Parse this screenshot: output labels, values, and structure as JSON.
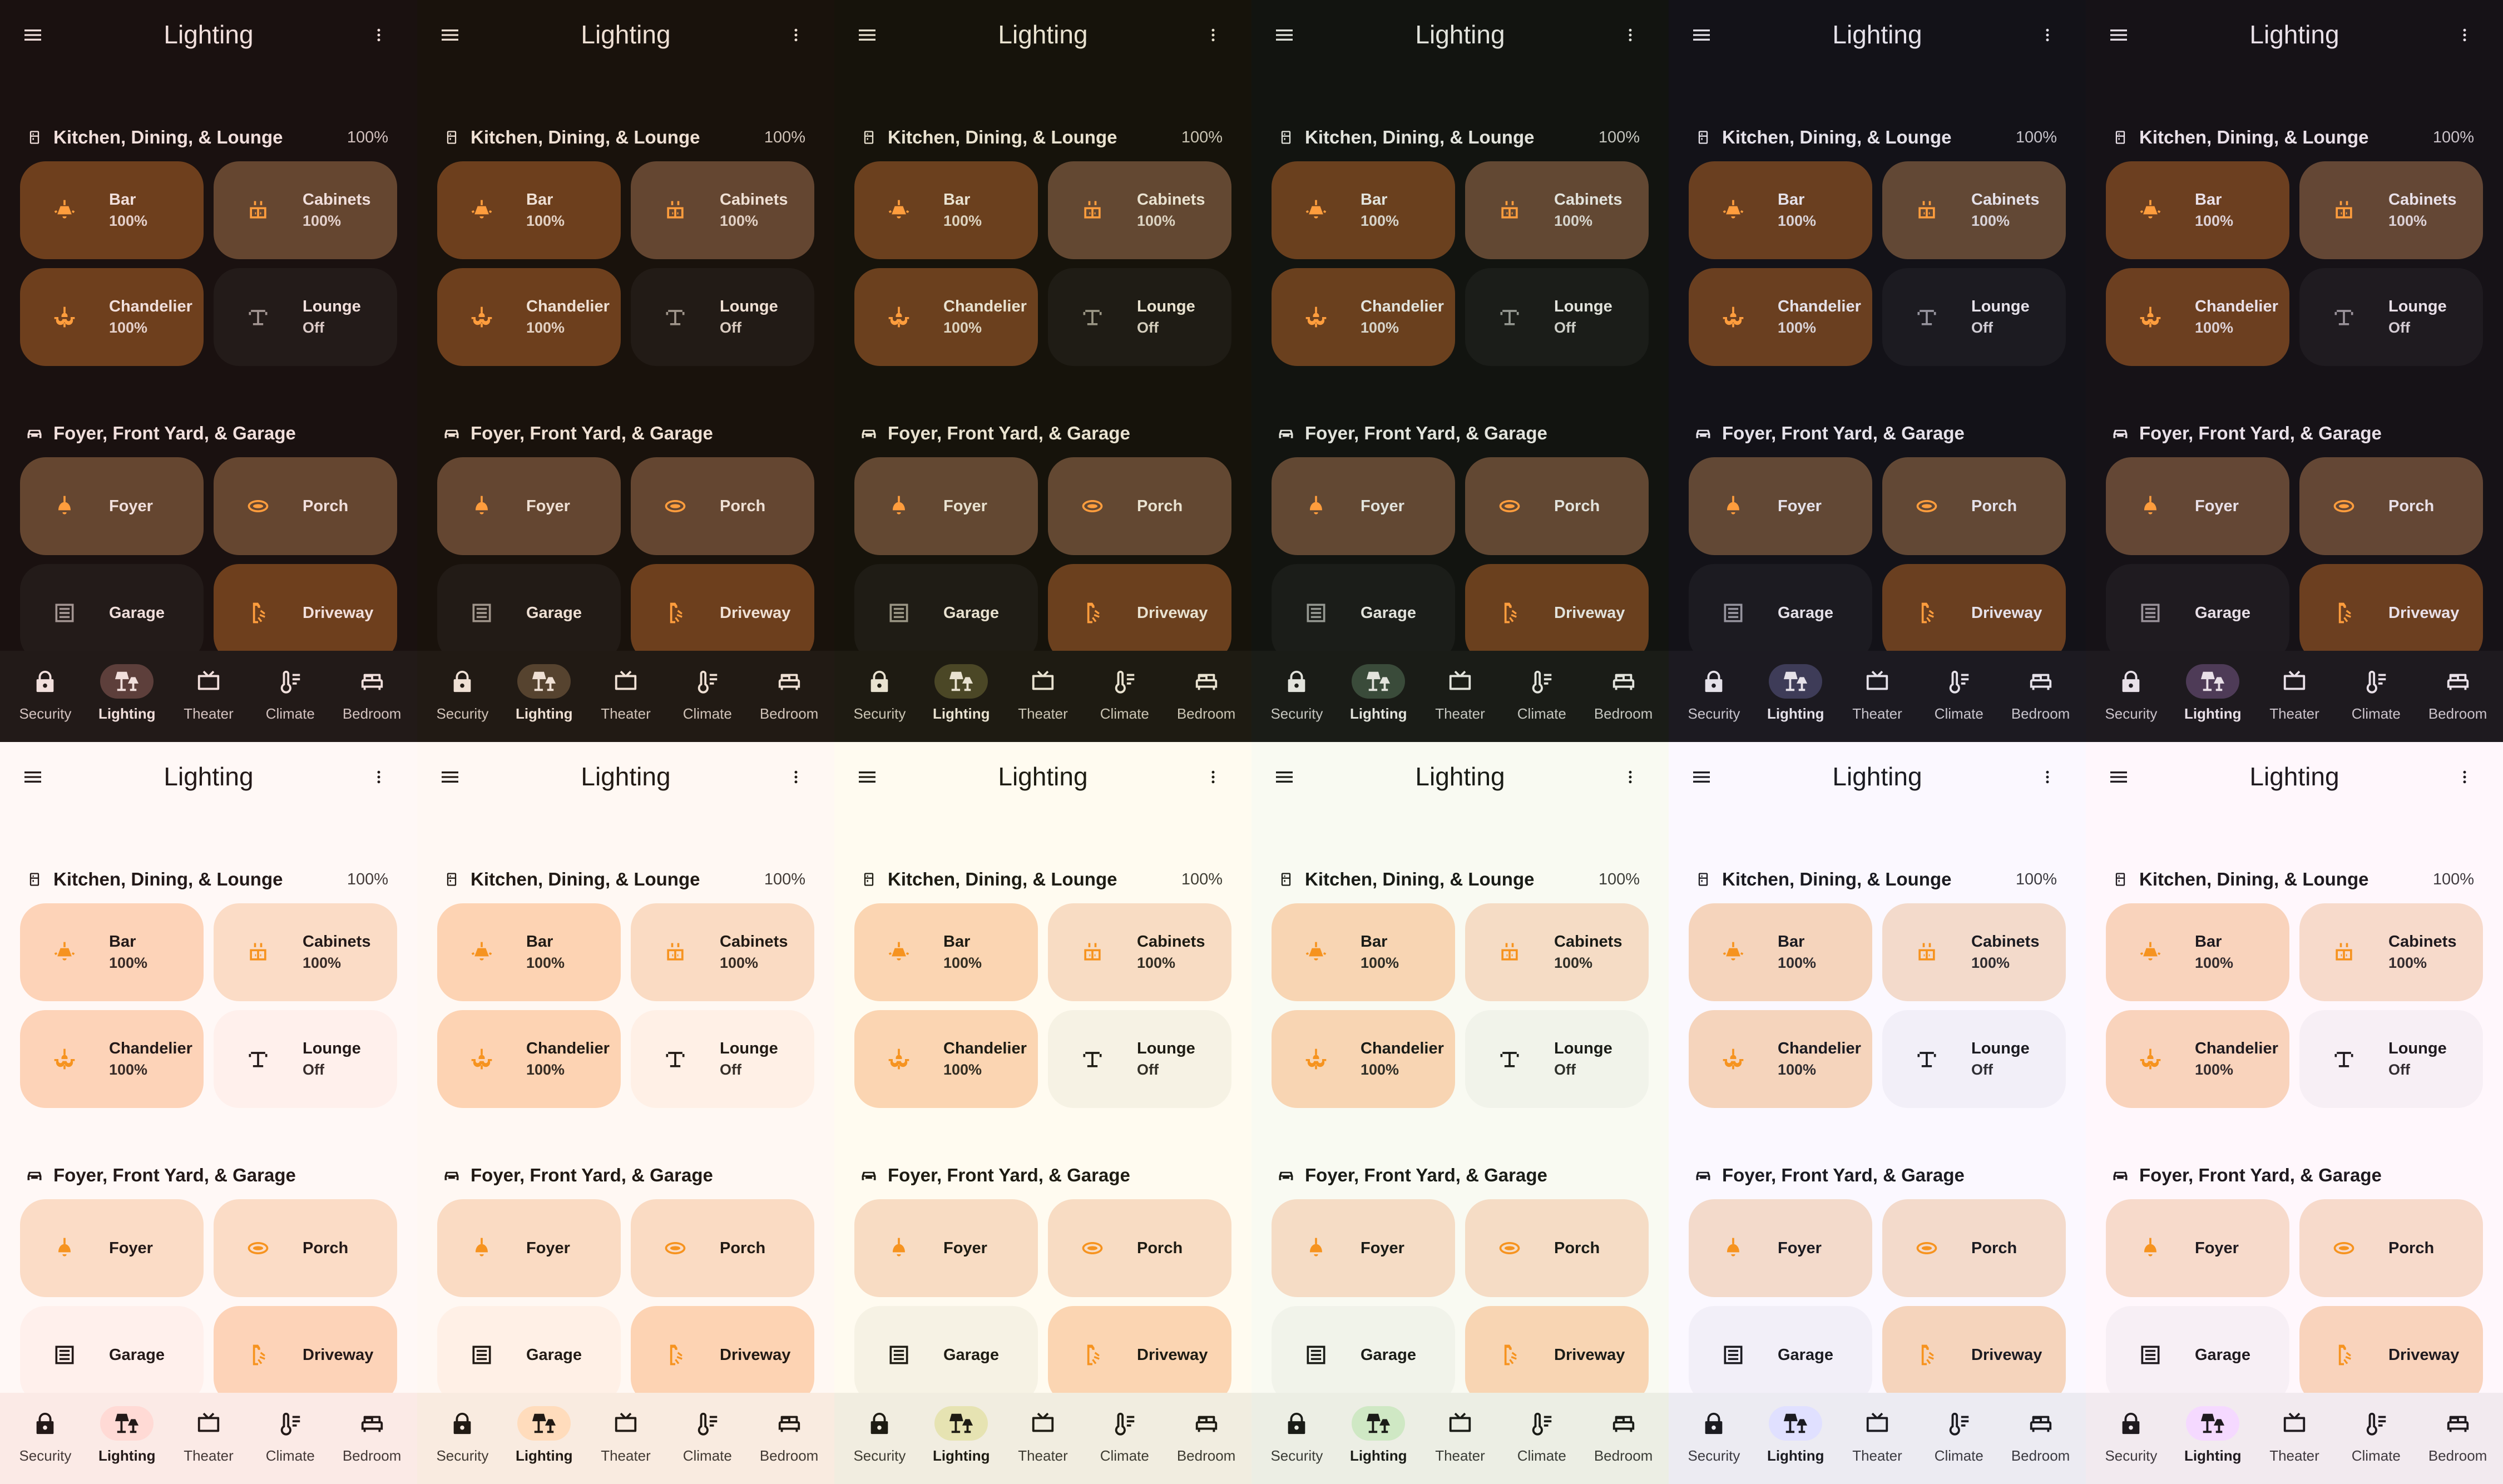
{
  "app_title": "Lighting",
  "sections": [
    {
      "title": "Kitchen, Dining, & Lounge",
      "icon": "fridge-icon",
      "percent": "100%",
      "lights": [
        {
          "name": "Bar",
          "state": "100%",
          "on": true,
          "icon": "ceiling-lamp-icon"
        },
        {
          "name": "Cabinets",
          "state": "100%",
          "on": true,
          "icon": "cabinet-light-icon"
        },
        {
          "name": "Chandelier",
          "state": "100%",
          "on": true,
          "icon": "chandelier-icon"
        },
        {
          "name": "Lounge",
          "state": "Off",
          "on": false,
          "icon": "floor-lamp-icon"
        }
      ]
    },
    {
      "title": "Foyer, Front Yard, & Garage",
      "icon": "car-icon",
      "percent": "",
      "lights": [
        {
          "name": "Foyer",
          "state": "",
          "on": true,
          "icon": "pendant-light-icon"
        },
        {
          "name": "Porch",
          "state": "",
          "on": true,
          "icon": "ring-light-icon"
        },
        {
          "name": "Garage",
          "state": "",
          "on": false,
          "icon": "garage-icon"
        },
        {
          "name": "Driveway",
          "state": "",
          "on": true,
          "icon": "outdoor-lamp-icon"
        }
      ]
    }
  ],
  "nav": [
    {
      "label": "Security",
      "icon": "lock-icon",
      "active": false
    },
    {
      "label": "Lighting",
      "icon": "lamps-icon",
      "active": true
    },
    {
      "label": "Theater",
      "icon": "tv-icon",
      "active": false
    },
    {
      "label": "Climate",
      "icon": "thermometer-icon",
      "active": false
    },
    {
      "label": "Bedroom",
      "icon": "bed-icon",
      "active": false
    }
  ],
  "themes": [
    {
      "bg": "#1a1110",
      "fg": "#f1dfdc",
      "on": "#6e3f1d",
      "on2": "#654630",
      "off": "#231b19",
      "ico": "#ff9d3d",
      "icoOff": "#a39592",
      "nav": "#221a18",
      "pill": "#5d3f3b"
    },
    {
      "bg": "#19120c",
      "fg": "#efe0d4",
      "on": "#6d3f1d",
      "on2": "#644631",
      "off": "#221b16",
      "ico": "#ff9d3d",
      "icoOff": "#a0958b",
      "nav": "#211a14",
      "pill": "#56432f"
    },
    {
      "bg": "#16130b",
      "fg": "#e9e2d0",
      "on": "#6b401e",
      "on2": "#634832",
      "off": "#1f1c15",
      "ico": "#ff9d3d",
      "icoOff": "#9b9685",
      "nav": "#1e1b12",
      "pill": "#4b4726"
    },
    {
      "bg": "#121410",
      "fg": "#e2e3dc",
      "on": "#6a401e",
      "on2": "#624833",
      "off": "#1b1d19",
      "ico": "#ff9d3d",
      "icoOff": "#959891",
      "nav": "#1a1c17",
      "pill": "#3a4b3a"
    },
    {
      "bg": "#131218",
      "fg": "#e5e1e9",
      "on": "#6a3f20",
      "on2": "#624835",
      "off": "#1c1b21",
      "ico": "#ff9d3d",
      "icoOff": "#96949e",
      "nav": "#1c1a21",
      "pill": "#3e3c58"
    },
    {
      "bg": "#161217",
      "fg": "#e9e0e8",
      "on": "#6c3f20",
      "on2": "#644735",
      "off": "#1f1b20",
      "ico": "#ff9d3d",
      "icoOff": "#9a929a",
      "nav": "#1e1a1f",
      "pill": "#4e3b57"
    },
    {
      "bg": "#fff8f6",
      "fg": "#231918",
      "on": "#fdd3b8",
      "on2": "#fbdcc6",
      "off": "#fff0ec",
      "ico": "#f6931f",
      "icoOff": "#231918",
      "nav": "#fbeae6",
      "pill": "#ffdad5"
    },
    {
      "bg": "#fff8f3",
      "fg": "#211a14",
      "on": "#fdd3b3",
      "on2": "#fadbc3",
      "off": "#fff0e6",
      "ico": "#f6931f",
      "icoOff": "#211a14",
      "nav": "#f9ebe0",
      "pill": "#ffdcbc"
    },
    {
      "bg": "#fffbf0",
      "fg": "#1e1c13",
      "on": "#fbd5b2",
      "on2": "#f8dcc3",
      "off": "#f6f2e4",
      "ico": "#f6931f",
      "icoOff": "#1e1c13",
      "nav": "#f1ede0",
      "pill": "#e6e3b2"
    },
    {
      "bg": "#f9faf2",
      "fg": "#1a1c17",
      "on": "#f8d5b3",
      "on2": "#f5dcc5",
      "off": "#f1f3ea",
      "ico": "#f6931f",
      "icoOff": "#1a1c17",
      "nav": "#eceee4",
      "pill": "#cfe8c4"
    },
    {
      "bg": "#fbf8ff",
      "fg": "#1b1b21",
      "on": "#f5d4bc",
      "on2": "#f3dacb",
      "off": "#f2eff8",
      "ico": "#f6931f",
      "icoOff": "#1b1b21",
      "nav": "#ecebf2",
      "pill": "#e0e0ff"
    },
    {
      "bg": "#fff7fc",
      "fg": "#1f1a1f",
      "on": "#f9d3bc",
      "on2": "#f7dacb",
      "off": "#f7eff5",
      "ico": "#f6931f",
      "icoOff": "#1f1a1f",
      "nav": "#f2eaef",
      "pill": "#f5d9ff"
    }
  ]
}
